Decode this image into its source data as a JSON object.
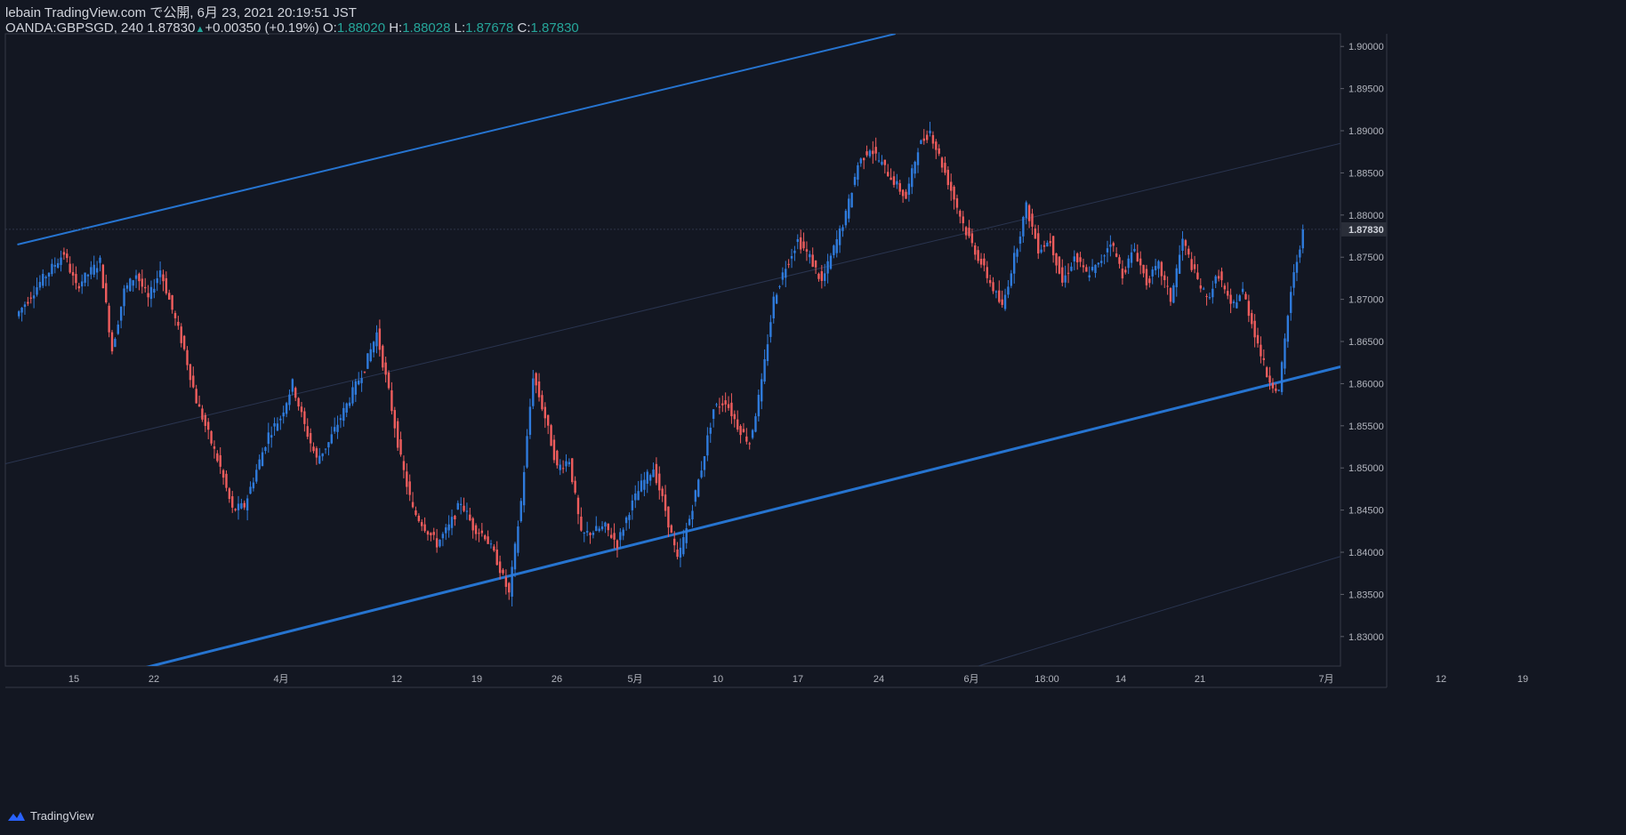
{
  "header": {
    "line1": "lebain TradingView.com で公開, 6月 23, 2021 20:19:51 JST",
    "symbol": "OANDA:GBPSGD, 240",
    "last": "1.87830",
    "change": "+0.00350 (+0.19%)",
    "o_label": "O:",
    "o_value": "1.88020",
    "h_label": "H:",
    "h_value": "1.88028",
    "l_label": "L:",
    "l_value": "1.87678",
    "c_label": "C:",
    "c_value": "1.87830"
  },
  "footer": {
    "brand": "TradingView"
  },
  "colors": {
    "background": "#131722",
    "up": "#2f7bdc",
    "down": "#f05d5d",
    "channel": "#2674d0",
    "axis_text": "#b2b5be",
    "change_up": "#26a69a"
  },
  "chart_data": {
    "type": "candlestick",
    "symbol": "OANDA:GBPSGD",
    "interval": "240",
    "y_axis": {
      "side": "right",
      "range": [
        1.8265,
        1.9015
      ],
      "ticks": [
        "1.83000",
        "1.83500",
        "1.84000",
        "1.84500",
        "1.85000",
        "1.85500",
        "1.86000",
        "1.86500",
        "1.87000",
        "1.87500",
        "1.88000",
        "1.88500",
        "1.89000",
        "1.89500",
        "1.90000"
      ]
    },
    "x_axis_labels": [
      "15",
      "22",
      "4月",
      "12",
      "19",
      "26",
      "5月",
      "10",
      "17",
      "24",
      "6月",
      "18:00",
      "14",
      "21",
      "7月",
      "12",
      "19"
    ],
    "x_range": [
      "2021-03-07",
      "2021-06-26"
    ],
    "last_price_label": "1.87830",
    "close_path": [
      [
        "2021-03-08",
        1.868
      ],
      [
        "2021-03-10",
        1.872
      ],
      [
        "2021-03-12",
        1.8755
      ],
      [
        "2021-03-13",
        1.8715
      ],
      [
        "2021-03-15",
        1.8745
      ],
      [
        "2021-03-16",
        1.864
      ],
      [
        "2021-03-17",
        1.871
      ],
      [
        "2021-03-18",
        1.873
      ],
      [
        "2021-03-19",
        1.87
      ],
      [
        "2021-03-20",
        1.8735
      ],
      [
        "2021-03-22",
        1.864
      ],
      [
        "2021-03-23",
        1.858
      ],
      [
        "2021-03-24",
        1.854
      ],
      [
        "2021-03-25",
        1.85
      ],
      [
        "2021-03-26",
        1.845
      ],
      [
        "2021-03-27",
        1.8455
      ],
      [
        "2021-03-29",
        1.854
      ],
      [
        "2021-03-30",
        1.856
      ],
      [
        "2021-03-31",
        1.86
      ],
      [
        "2021-04-01",
        1.855
      ],
      [
        "2021-04-02",
        1.851
      ],
      [
        "2021-04-03",
        1.853
      ],
      [
        "2021-04-05",
        1.859
      ],
      [
        "2021-04-06",
        1.862
      ],
      [
        "2021-04-07",
        1.866
      ],
      [
        "2021-04-08",
        1.859
      ],
      [
        "2021-04-09",
        1.851
      ],
      [
        "2021-04-10",
        1.845
      ],
      [
        "2021-04-11",
        1.843
      ],
      [
        "2021-04-12",
        1.841
      ],
      [
        "2021-04-13",
        1.843
      ],
      [
        "2021-04-14",
        1.846
      ],
      [
        "2021-04-15",
        1.843
      ],
      [
        "2021-04-16",
        1.842
      ],
      [
        "2021-04-17",
        1.839
      ],
      [
        "2021-04-18",
        1.835
      ],
      [
        "2021-04-19",
        1.846
      ],
      [
        "2021-04-20",
        1.861
      ],
      [
        "2021-04-21",
        1.856
      ],
      [
        "2021-04-22",
        1.85
      ],
      [
        "2021-04-23",
        1.851
      ],
      [
        "2021-04-24",
        1.842
      ],
      [
        "2021-04-26",
        1.843
      ],
      [
        "2021-04-27",
        1.841
      ],
      [
        "2021-04-28",
        1.845
      ],
      [
        "2021-04-29",
        1.848
      ],
      [
        "2021-04-30",
        1.85
      ],
      [
        "2021-05-01",
        1.845
      ],
      [
        "2021-05-02",
        1.839
      ],
      [
        "2021-05-03",
        1.844
      ],
      [
        "2021-05-04",
        1.85
      ],
      [
        "2021-05-05",
        1.857
      ],
      [
        "2021-05-06",
        1.858
      ],
      [
        "2021-05-07",
        1.855
      ],
      [
        "2021-05-08",
        1.853
      ],
      [
        "2021-05-09",
        1.86
      ],
      [
        "2021-05-10",
        1.87
      ],
      [
        "2021-05-11",
        1.874
      ],
      [
        "2021-05-12",
        1.877
      ],
      [
        "2021-05-13",
        1.875
      ],
      [
        "2021-05-14",
        1.872
      ],
      [
        "2021-05-15",
        1.876
      ],
      [
        "2021-05-16",
        1.88
      ],
      [
        "2021-05-17",
        1.886
      ],
      [
        "2021-05-18",
        1.888
      ],
      [
        "2021-05-19",
        1.886
      ],
      [
        "2021-05-20",
        1.884
      ],
      [
        "2021-05-21",
        1.882
      ],
      [
        "2021-05-22",
        1.888
      ],
      [
        "2021-05-23",
        1.89
      ],
      [
        "2021-05-24",
        1.886
      ],
      [
        "2021-05-25",
        1.882
      ],
      [
        "2021-05-26",
        1.878
      ],
      [
        "2021-05-27",
        1.875
      ],
      [
        "2021-05-28",
        1.872
      ],
      [
        "2021-05-29",
        1.869
      ],
      [
        "2021-05-30",
        1.875
      ],
      [
        "2021-05-31",
        1.881
      ],
      [
        "2021-06-01",
        1.876
      ],
      [
        "2021-06-02",
        1.877
      ],
      [
        "2021-06-03",
        1.872
      ],
      [
        "2021-06-04",
        1.875
      ],
      [
        "2021-06-05",
        1.873
      ],
      [
        "2021-06-06",
        1.874
      ],
      [
        "2021-06-07",
        1.877
      ],
      [
        "2021-06-08",
        1.873
      ],
      [
        "2021-06-09",
        1.876
      ],
      [
        "2021-06-10",
        1.872
      ],
      [
        "2021-06-11",
        1.874
      ],
      [
        "2021-06-12",
        1.87
      ],
      [
        "2021-06-13",
        1.877
      ],
      [
        "2021-06-14",
        1.873
      ],
      [
        "2021-06-15",
        1.87
      ],
      [
        "2021-06-16",
        1.873
      ],
      [
        "2021-06-17",
        1.869
      ],
      [
        "2021-06-18",
        1.871
      ],
      [
        "2021-06-19",
        1.866
      ],
      [
        "2021-06-20",
        1.861
      ],
      [
        "2021-06-21",
        1.859
      ],
      [
        "2021-06-22",
        1.871
      ],
      [
        "2021-06-23",
        1.8783
      ]
    ],
    "channel": {
      "start": [
        "2021-03-08",
        1.8765
      ],
      "end": [
        "2021-05-20",
        1.9015
      ],
      "lower_start": [
        "2021-03-08",
        1.8225
      ],
      "lower_end": [
        "2021-06-26",
        1.862
      ]
    }
  }
}
